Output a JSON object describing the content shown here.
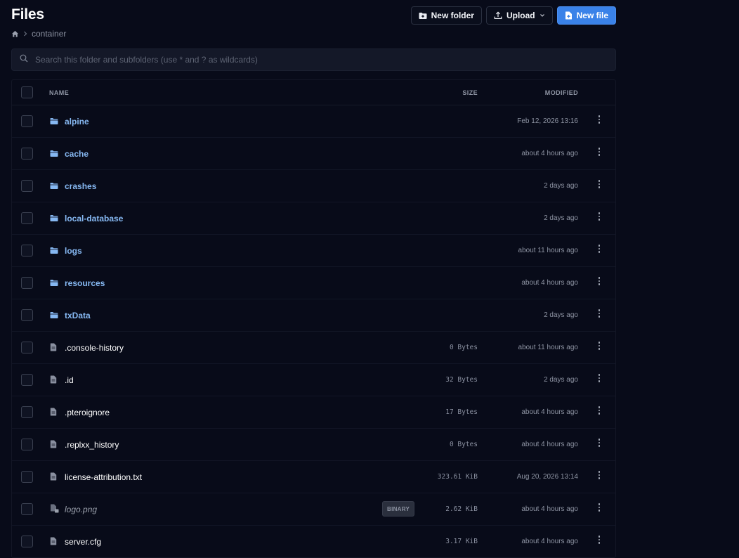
{
  "header": {
    "title": "Files",
    "breadcrumb": [
      "container"
    ]
  },
  "toolbar": {
    "new_folder": "New folder",
    "upload": "Upload",
    "new_file": "New file"
  },
  "search": {
    "placeholder": "Search this folder and subfolders (use * and ? as wildcards)"
  },
  "table": {
    "columns": {
      "name": "NAME",
      "size": "SIZE",
      "modified": "MODIFIED"
    },
    "rows": [
      {
        "type": "folder",
        "name": "alpine",
        "size": "",
        "modified": "Feb 12, 2026 13:16"
      },
      {
        "type": "folder",
        "name": "cache",
        "size": "",
        "modified": "about 4 hours ago"
      },
      {
        "type": "folder",
        "name": "crashes",
        "size": "",
        "modified": "2 days ago"
      },
      {
        "type": "folder",
        "name": "local-database",
        "size": "",
        "modified": "2 days ago"
      },
      {
        "type": "folder",
        "name": "logs",
        "size": "",
        "modified": "about 11 hours ago"
      },
      {
        "type": "folder",
        "name": "resources",
        "size": "",
        "modified": "about 4 hours ago"
      },
      {
        "type": "folder",
        "name": "txData",
        "size": "",
        "modified": "2 days ago"
      },
      {
        "type": "file",
        "name": ".console-history",
        "size": "0 Bytes",
        "modified": "about 11 hours ago"
      },
      {
        "type": "file",
        "name": ".id",
        "size": "32 Bytes",
        "modified": "2 days ago"
      },
      {
        "type": "file",
        "name": ".pteroignore",
        "size": "17 Bytes",
        "modified": "about 4 hours ago"
      },
      {
        "type": "file",
        "name": ".replxx_history",
        "size": "0 Bytes",
        "modified": "about 4 hours ago"
      },
      {
        "type": "file",
        "name": "license-attribution.txt",
        "size": "323.61 KiB",
        "modified": "Aug 20, 2026 13:14"
      },
      {
        "type": "binary",
        "name": "logo.png",
        "badge": "BINARY",
        "size": "2.62 KiB",
        "modified": "about 4 hours ago"
      },
      {
        "type": "file",
        "name": "server.cfg",
        "size": "3.17 KiB",
        "modified": "about 4 hours ago"
      }
    ]
  },
  "colors": {
    "background": "#080b19",
    "accent": "#3a82e8",
    "folder": "#86b8f2"
  }
}
